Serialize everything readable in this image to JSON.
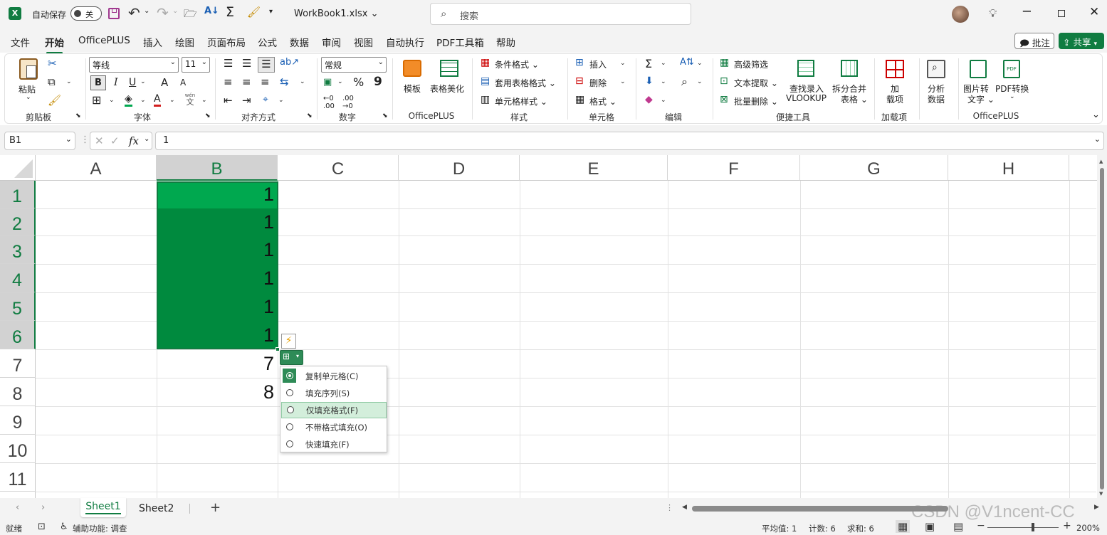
{
  "titlebar": {
    "autosave_label": "自动保存",
    "autosave_state": "关",
    "filename": "WorkBook1.xlsx",
    "search_placeholder": "搜索",
    "excel_logo": "X"
  },
  "ribbon_tabs": [
    "文件",
    "开始",
    "OfficePLUS",
    "插入",
    "绘图",
    "页面布局",
    "公式",
    "数据",
    "审阅",
    "视图",
    "自动执行",
    "PDF工具箱",
    "帮助"
  ],
  "active_tab": "开始",
  "comments_button": "批注",
  "share_button": "共享",
  "clipboard": {
    "paste": "粘贴",
    "group": "剪贴板"
  },
  "font": {
    "name": "等线",
    "size": "11",
    "group": "字体",
    "bold": "B",
    "italic": "I",
    "underline": "U",
    "grow": "A",
    "shrink": "A",
    "color_a": "A",
    "phonetic": "wén",
    "phonetic_char": "文"
  },
  "alignment": {
    "group": "对齐方式"
  },
  "number": {
    "format": "常规",
    "group": "数字",
    "percent": "%",
    "comma": "9"
  },
  "officeplus1": {
    "template": "模板",
    "beautify": "表格美化",
    "group": "OfficePLUS"
  },
  "styles": {
    "conditional": "条件格式",
    "table_format": "套用表格格式",
    "cell_styles": "单元格样式",
    "group": "样式"
  },
  "cells": {
    "insert": "插入",
    "delete": "删除",
    "format": "格式",
    "group": "单元格"
  },
  "editing": {
    "group": "编辑",
    "sigma": "Σ"
  },
  "tools": {
    "advanced_filter": "高级筛选",
    "text_extract": "文本提取",
    "batch_delete": "批量删除",
    "lookup_line1": "查找录入",
    "lookup_line2": "VLOOKUP",
    "split_line1": "拆分合并",
    "split_line2": "表格",
    "group": "便捷工具"
  },
  "addins": {
    "line1": "加",
    "line2": "载项",
    "group": "加载项"
  },
  "analyze": {
    "line1": "分析",
    "line2": "数据"
  },
  "officeplus2": {
    "img_line1": "图片转",
    "img_line2": "文字",
    "pdf_line1": "PDF转换",
    "pdf_icon_text": "PDF",
    "group": "OfficePLUS"
  },
  "formula_bar": {
    "name_box": "B1",
    "fx": "fx",
    "value": "1"
  },
  "columns": [
    "A",
    "B",
    "C",
    "D",
    "E",
    "F",
    "G",
    "H"
  ],
  "rows": [
    "1",
    "2",
    "3",
    "4",
    "5",
    "6",
    "7",
    "8",
    "9",
    "10",
    "11"
  ],
  "cell_values": {
    "B1": "1",
    "B2": "1",
    "B3": "1",
    "B4": "1",
    "B5": "1",
    "B6": "1",
    "B7": "7",
    "B8": "8"
  },
  "autofill_menu": [
    {
      "label": "复制单元格(C)",
      "selected": true
    },
    {
      "label": "填充序列(S)",
      "selected": false
    },
    {
      "label": "仅填充格式(F)",
      "selected": false,
      "hover": true
    },
    {
      "label": "不带格式填充(O)",
      "selected": false
    },
    {
      "label": "快速填充(F)",
      "selected": false
    }
  ],
  "sheets": [
    "Sheet1",
    "Sheet2"
  ],
  "active_sheet": "Sheet1",
  "status": {
    "ready": "就绪",
    "accessibility": "辅助功能: 调查",
    "average": "平均值: 1",
    "count": "计数: 6",
    "sum": "求和: 6",
    "zoom": "200%"
  },
  "watermark": "CSDN @V1ncent-CC",
  "colors": {
    "accent": "#107c41",
    "selection_fill": "#008a3e",
    "selection_active": "#00a84f",
    "menu_hover": "#d3eedb"
  }
}
